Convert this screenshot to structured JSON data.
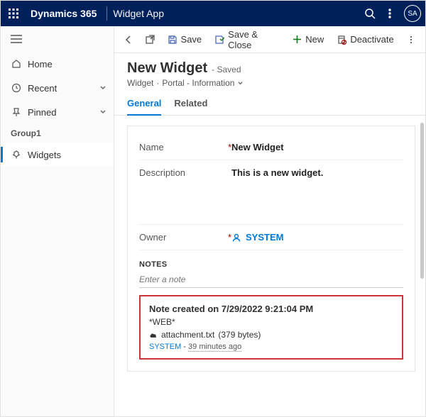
{
  "topbar": {
    "brand": "Dynamics 365",
    "app_name": "Widget App",
    "user_initials": "SA"
  },
  "sidebar": {
    "items": [
      {
        "label": "Home"
      },
      {
        "label": "Recent"
      },
      {
        "label": "Pinned"
      },
      {
        "label": "Widgets"
      }
    ],
    "group_label": "Group1"
  },
  "commands": {
    "save": "Save",
    "save_close": "Save & Close",
    "new": "New",
    "deactivate": "Deactivate"
  },
  "record": {
    "title": "New Widget",
    "saved_status": "- Saved",
    "entity": "Widget",
    "form": "Portal - Information"
  },
  "tabs": [
    "General",
    "Related"
  ],
  "fields": {
    "name": {
      "label": "Name",
      "value": "New Widget",
      "required": true
    },
    "description": {
      "label": "Description",
      "value": "This is a new widget."
    },
    "owner": {
      "label": "Owner",
      "value": "SYSTEM",
      "required": true
    }
  },
  "notes": {
    "heading": "NOTES",
    "placeholder": "Enter a note",
    "item": {
      "title": "Note created on 7/29/2022 9:21:04 PM",
      "body": "*WEB*",
      "attachment": {
        "name": "attachment.txt",
        "size": "(379 bytes)"
      },
      "author": "SYSTEM",
      "time_ago": "39 minutes ago"
    }
  }
}
